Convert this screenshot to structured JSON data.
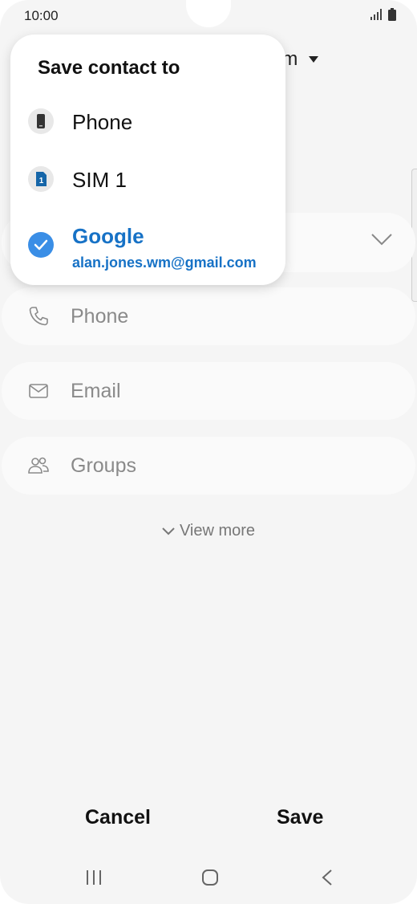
{
  "status_bar": {
    "time": "10:00"
  },
  "header": {
    "account_selector_partial": "om"
  },
  "popup": {
    "title": "Save contact to",
    "options": [
      {
        "label": "Phone",
        "icon": "phone-device-icon"
      },
      {
        "label": "SIM 1",
        "icon": "sim-card-icon",
        "badge": "1"
      },
      {
        "label": "Google",
        "sublabel": "alan.jones.wm@gmail.com",
        "icon": "check-circle-icon",
        "selected": true
      }
    ]
  },
  "fields": {
    "phone_placeholder": "Phone",
    "email_placeholder": "Email",
    "groups_placeholder": "Groups"
  },
  "view_more": "View more",
  "actions": {
    "cancel": "Cancel",
    "save": "Save"
  },
  "colors": {
    "accent": "#1772c6",
    "check": "#3a8ee6",
    "background": "#f5f5f5"
  }
}
